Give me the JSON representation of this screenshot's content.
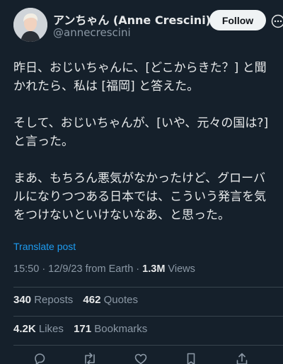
{
  "author": {
    "display_name": "アンちゃん (Anne Crescini)",
    "handle": "@annecrescini",
    "follow_label": "Follow"
  },
  "tweet": {
    "paragraphs": [
      [
        "昨日、おじいちゃんに、[どこからきた？] と聞",
        "かれたら、私は [福岡] と答えた。"
      ],
      [
        "そして、おじいちゃんが、[いや、元々の国は?]",
        "と言った。"
      ],
      [
        "まあ、もちろん悪気がなかったけど、グローバ",
        "ルになりつつある日本では、こういう発言を気",
        "をつけないといけないなあ、と思った。"
      ]
    ],
    "translate_label": "Translate post",
    "timestamp": "15:50 · 12/9/23 from Earth · ",
    "views_count": "1.3M",
    "views_label": " Views"
  },
  "stats": {
    "reposts_count": "340",
    "reposts_label": "Reposts",
    "quotes_count": "462",
    "quotes_label": "Quotes",
    "likes_count": "4.2K",
    "likes_label": "Likes",
    "bookmarks_count": "171",
    "bookmarks_label": "Bookmarks"
  },
  "actions": [
    "reply-icon",
    "repost-icon",
    "like-icon",
    "bookmark-icon",
    "share-icon"
  ],
  "colors": {
    "background": "#15202b",
    "text": "#e7e9ea",
    "muted": "#8b98a5",
    "link": "#1d9bf0",
    "divider": "#38444d"
  }
}
